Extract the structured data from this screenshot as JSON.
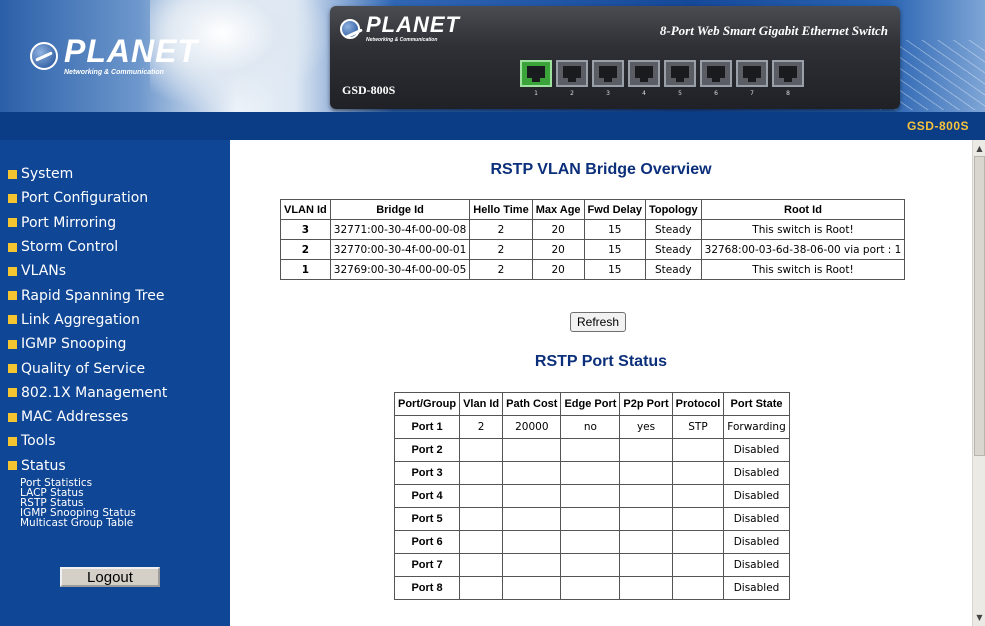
{
  "header": {
    "brand": "PLANET",
    "brand_tagline": "Networking & Communication",
    "device_title": "8-Port Web Smart Gigabit Ethernet Switch",
    "device_model": "GSD-800S",
    "ports": [
      "1",
      "2",
      "3",
      "4",
      "5",
      "6",
      "7",
      "8"
    ],
    "active_ports": [
      "1"
    ]
  },
  "topbar": {
    "model": "GSD-800S"
  },
  "sidebar": {
    "items": [
      {
        "label": "System"
      },
      {
        "label": "Port Configuration"
      },
      {
        "label": "Port Mirroring"
      },
      {
        "label": "Storm Control"
      },
      {
        "label": "VLANs"
      },
      {
        "label": "Rapid Spanning Tree"
      },
      {
        "label": "Link Aggregation"
      },
      {
        "label": "IGMP Snooping"
      },
      {
        "label": "Quality of Service"
      },
      {
        "label": "802.1X Management"
      },
      {
        "label": "MAC Addresses"
      },
      {
        "label": "Tools"
      },
      {
        "label": "Status"
      }
    ],
    "subitems": [
      {
        "label": "Port Statistics"
      },
      {
        "label": "LACP Status"
      },
      {
        "label": "RSTP Status"
      },
      {
        "label": "IGMP Snooping Status"
      },
      {
        "label": "Multicast Group Table"
      }
    ],
    "logout_label": "Logout"
  },
  "bridge_overview": {
    "title": "RSTP VLAN Bridge Overview",
    "columns": [
      "VLAN Id",
      "Bridge Id",
      "Hello Time",
      "Max Age",
      "Fwd Delay",
      "Topology",
      "Root Id"
    ],
    "rows": [
      [
        "3",
        "32771:00-30-4f-00-00-08",
        "2",
        "20",
        "15",
        "Steady",
        "This switch is Root!"
      ],
      [
        "2",
        "32770:00-30-4f-00-00-01",
        "2",
        "20",
        "15",
        "Steady",
        "32768:00-03-6d-38-06-00 via port : 1"
      ],
      [
        "1",
        "32769:00-30-4f-00-00-05",
        "2",
        "20",
        "15",
        "Steady",
        "This switch is Root!"
      ]
    ]
  },
  "refresh_label": "Refresh",
  "port_status": {
    "title": "RSTP Port Status",
    "columns": [
      "Port/Group",
      "Vlan Id",
      "Path Cost",
      "Edge Port",
      "P2p Port",
      "Protocol",
      "Port State"
    ],
    "rows": [
      [
        "Port 1",
        "2",
        "20000",
        "no",
        "yes",
        "STP",
        "Forwarding"
      ],
      [
        "Port 2",
        "",
        "",
        "",
        "",
        "",
        "Disabled"
      ],
      [
        "Port 3",
        "",
        "",
        "",
        "",
        "",
        "Disabled"
      ],
      [
        "Port 4",
        "",
        "",
        "",
        "",
        "",
        "Disabled"
      ],
      [
        "Port 5",
        "",
        "",
        "",
        "",
        "",
        "Disabled"
      ],
      [
        "Port 6",
        "",
        "",
        "",
        "",
        "",
        "Disabled"
      ],
      [
        "Port 7",
        "",
        "",
        "",
        "",
        "",
        "Disabled"
      ],
      [
        "Port 8",
        "",
        "",
        "",
        "",
        "",
        "Disabled"
      ]
    ]
  },
  "colors": {
    "sidebar_bg": "#0f4696",
    "topbar_bg": "#0b3d86",
    "bullet": "#f5c431",
    "model_text": "#f7c33a",
    "section_title": "#0b2f7a"
  }
}
